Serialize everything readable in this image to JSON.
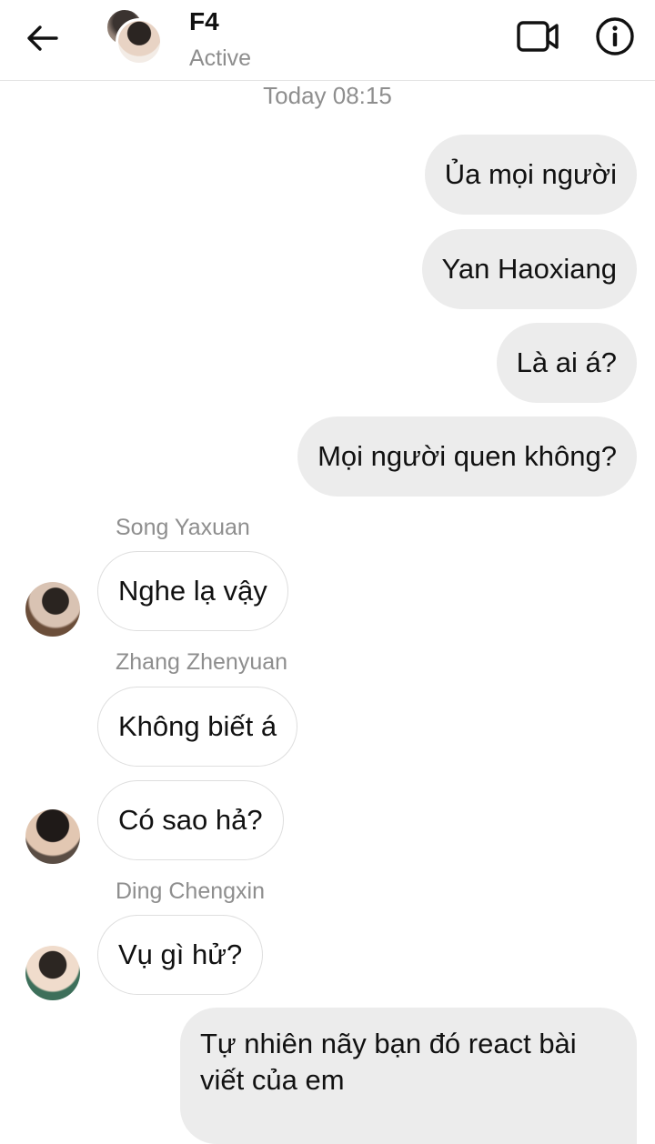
{
  "header": {
    "title": "F4",
    "status": "Active",
    "back_icon": "arrow-left-icon",
    "video_icon": "video-call-icon",
    "info_icon": "info-icon"
  },
  "timestamp": "Today 08:15",
  "messages": {
    "out": [
      "Ủa mọi người",
      "Yan Haoxiang",
      "Là ai á?",
      "Mọi người quen không?",
      "Tự nhiên nãy bạn đó react bài viết của em"
    ],
    "in": [
      {
        "sender": "Song Yaxuan",
        "text": "Nghe lạ vậy"
      },
      {
        "sender": "Zhang Zhenyuan",
        "text": "Không biết á"
      },
      {
        "text": "Có sao hả?"
      },
      {
        "sender": "Ding Chengxin",
        "text": "Vụ gì hử?"
      }
    ]
  },
  "colors": {
    "outgoing_bubble": "#ececec",
    "incoming_border": "#dedede",
    "muted_text": "#8e8e8e"
  }
}
